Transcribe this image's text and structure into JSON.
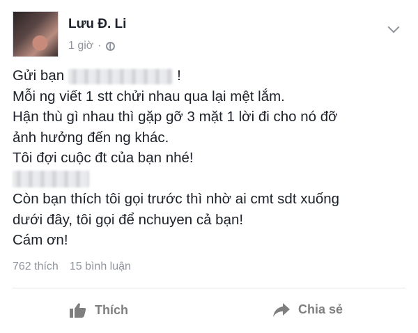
{
  "post": {
    "author_name": "Lưu Đ. Li",
    "timestamp": "1 giờ",
    "separator": "·",
    "privacy_icon": "globe-icon",
    "options_icon": "chevron-down-icon",
    "lines": {
      "l1_prefix": "Gửi bạn",
      "l1_suffix": "!",
      "l2": "Mỗi ng viết 1 stt chửi nhau qua lại mệt lắm.",
      "l3": "Hận thù gì nhau thì gặp gỡ 3 mặt 1 lời đi cho nó đỡ",
      "l4": "ảnh hưởng đến ng khác.",
      "l5": "Tôi đợi cuộc đt của bạn nhé!",
      "l7": "Còn bạn thích tôi gọi trước thì nhờ ai cmt sdt xuống",
      "l8": "dưới đây, tôi gọi để nchuyen cả bạn!",
      "l9": "Cám ơn!"
    }
  },
  "stats": {
    "likes": "762 thích",
    "comments": "15 bình luận"
  },
  "actions": {
    "like_label": "Thích",
    "like_icon": "thumbs-up-icon",
    "share_label": "Chia sẻ",
    "share_icon": "share-arrow-icon"
  },
  "colors": {
    "text": "#1d2129",
    "meta": "#90949c",
    "action": "#7f7f7f"
  }
}
